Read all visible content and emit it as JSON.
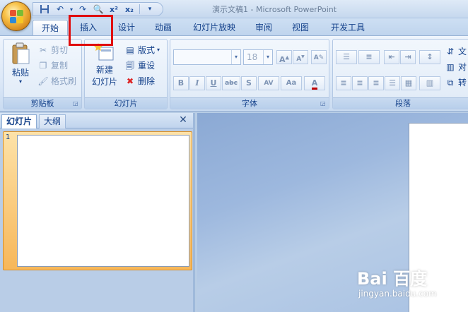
{
  "titlebar": {
    "text": "演示文稿1 - Microsoft PowerPoint"
  },
  "tabs": [
    {
      "label": "开始"
    },
    {
      "label": "插入"
    },
    {
      "label": "设计"
    },
    {
      "label": "动画"
    },
    {
      "label": "幻灯片放映"
    },
    {
      "label": "审阅"
    },
    {
      "label": "视图"
    },
    {
      "label": "开发工具"
    }
  ],
  "clipboard": {
    "paste": "粘贴",
    "cut": "剪切",
    "copy": "复制",
    "format_painter": "格式刷",
    "label": "剪贴板"
  },
  "slides_group": {
    "new_slide_line1": "新建",
    "new_slide_line2": "幻灯片",
    "layout": "版式",
    "reset": "重设",
    "delete": "删除",
    "label": "幻灯片"
  },
  "font": {
    "size": "18",
    "label": "字体",
    "bold": "B",
    "italic": "I",
    "underline": "U",
    "strike": "abc",
    "shadow": "S",
    "spacing": "AV",
    "case": "Aa",
    "color": "A"
  },
  "paragraph": {
    "label": "段落",
    "text_dir": "文",
    "align_text": "对",
    "convert": "转"
  },
  "pane": {
    "tab_slides": "幻灯片",
    "tab_outline": "大纲",
    "thumb_number": "1"
  },
  "watermark": {
    "logo": "Bai 百度",
    "url": "jingyan.baidu.com"
  },
  "colors": {
    "accent": "#15428b",
    "highlight": "#e00d0d",
    "selected_thumb": "#f7b75a"
  }
}
